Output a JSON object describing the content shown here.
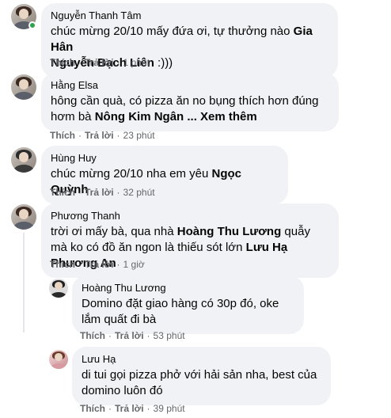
{
  "actions": {
    "like": "Thích",
    "reply": "Trả lời",
    "sep": "·"
  },
  "comments": [
    {
      "author": "Nguyễn Thanh Tâm",
      "text": "chúc mừng 20/10 mấy đứa ơi, tự thưởng nào ",
      "mention1": "Gia Hân",
      "mention2": "Nguyễn Bạch Liên",
      "tail": " :)))",
      "time": "1 phút",
      "online": true
    },
    {
      "author": "Hằng Elsa",
      "text": "hông cần quà, có pizza ăn no bụng thích hơn đúng hơm bà ",
      "mention1": "Nông Kim Ngân",
      "more": " ... Xem thêm",
      "time": "23 phút"
    },
    {
      "author": "Hùng Huy",
      "text": "chúc mừng 20/10 nha em yêu ",
      "mention1": "Ngọc Quỳnh",
      "time": "32 phút"
    },
    {
      "author": "Phương Thanh",
      "text1": "trời ơi mấy bà, qua nhà ",
      "mention1": "Hoàng Thu Lương",
      "text2": " quẫy mà ko có đồ ăn ngon là thiếu sót lớn ",
      "mention2": "Lưu Hạ Phương An",
      "time": "1 giờ"
    }
  ],
  "replies": [
    {
      "author": "Hoàng Thu Lương",
      "text": "Domino đặt giao hàng có 30p đó, oke lắm quất đi bà",
      "time": "53 phút"
    },
    {
      "author": "Lưu Hạ",
      "text": "di tui gọi pizza phở với hải sản nha, best của domino luôn đó",
      "time": "39 phút"
    }
  ]
}
